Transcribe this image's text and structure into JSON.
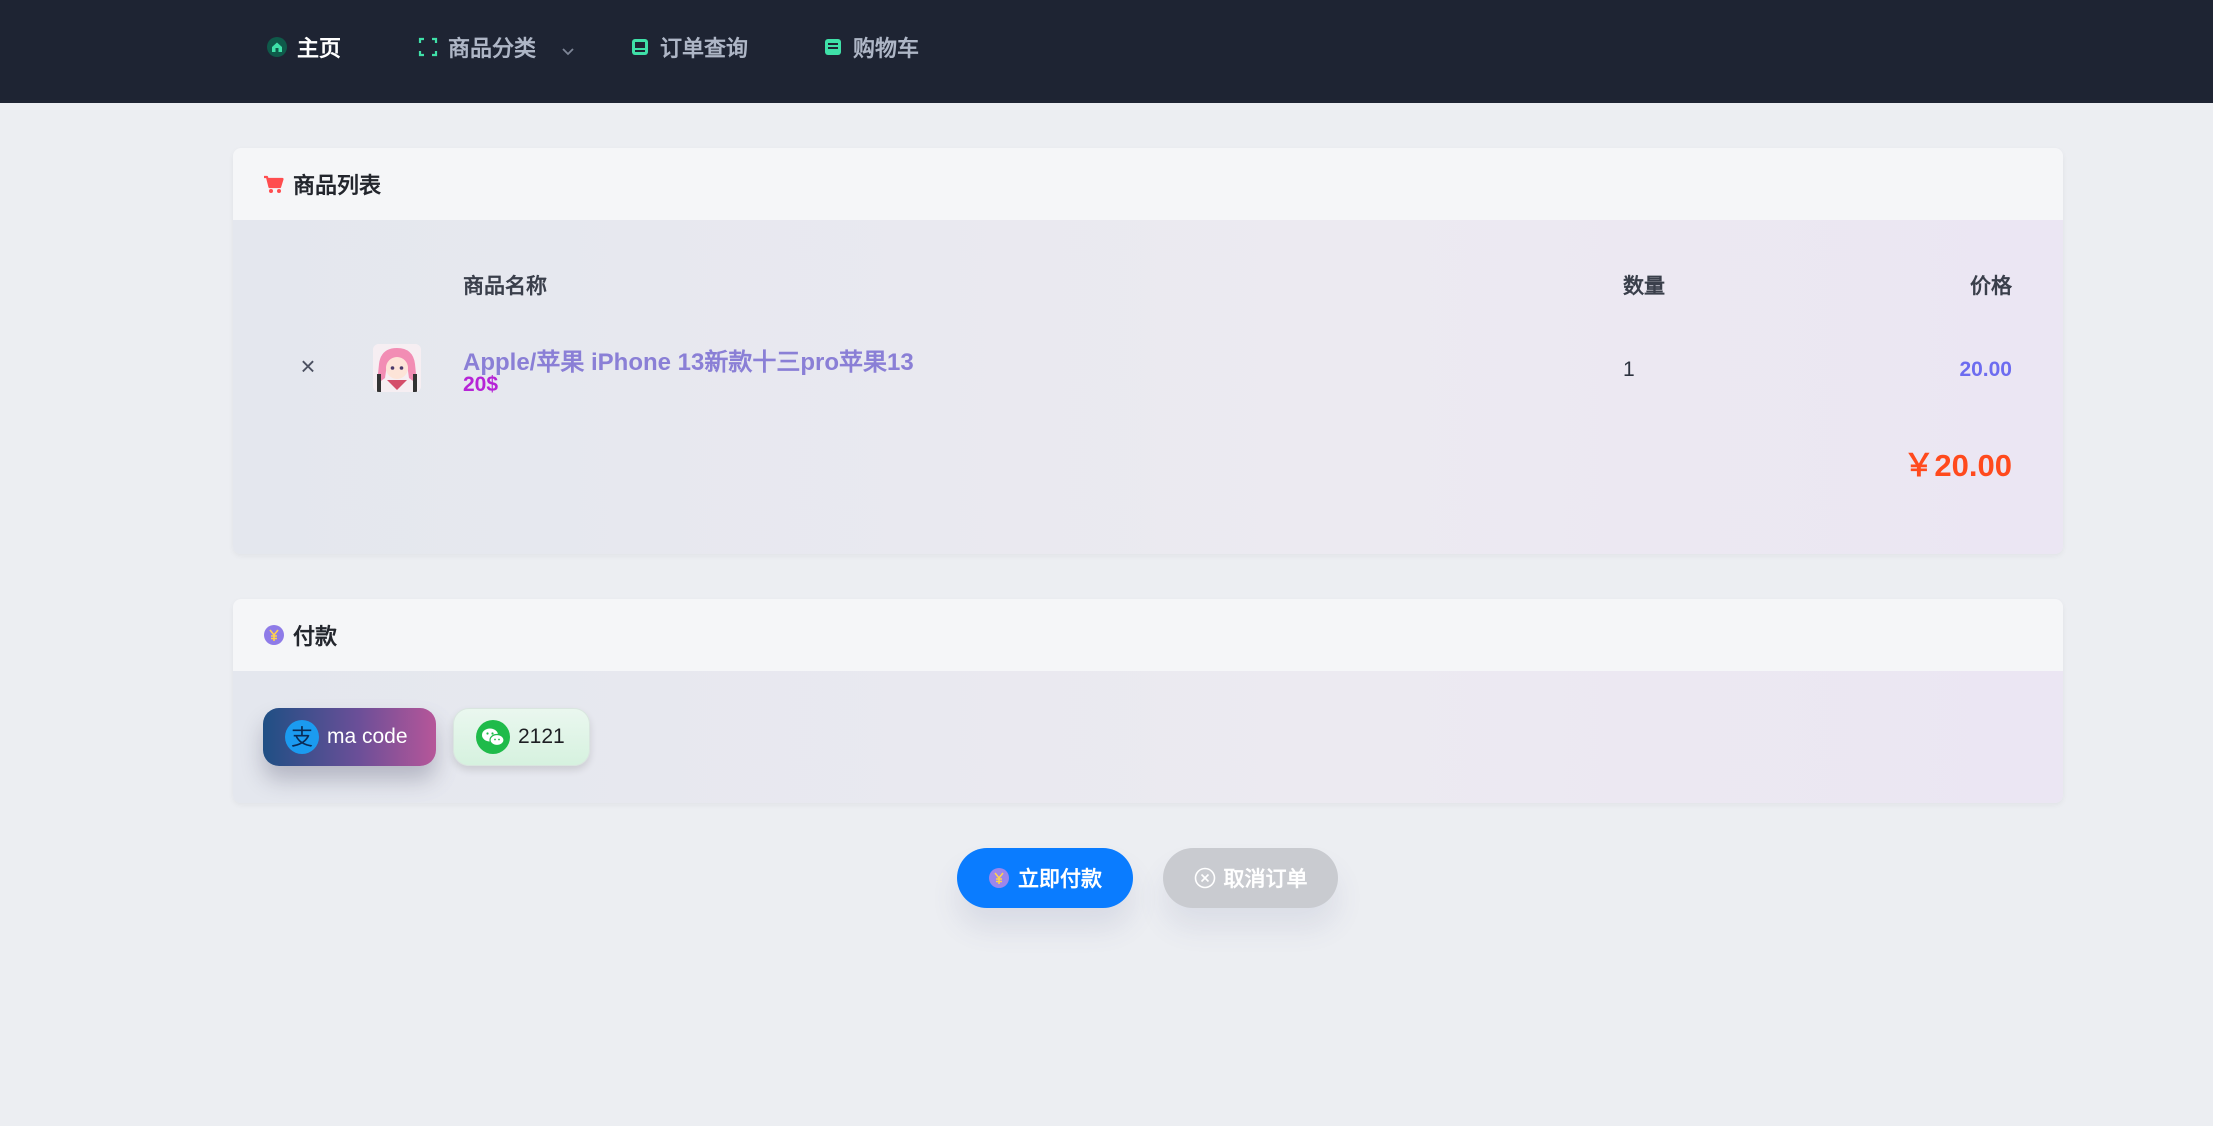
{
  "nav": {
    "home": "主页",
    "category": "商品分类",
    "order_query": "订单查询",
    "cart": "购物车"
  },
  "product_list": {
    "title": "商品列表",
    "columns": {
      "name": "商品名称",
      "quantity": "数量",
      "price": "价格"
    },
    "items": [
      {
        "remove": "×",
        "name": "Apple/苹果 iPhone 13新款十三pro苹果13",
        "unit_price": "20$",
        "quantity": "1",
        "price": "20.00"
      }
    ],
    "total": "￥20.00"
  },
  "payment": {
    "title": "付款",
    "methods": [
      {
        "icon": "alipay-icon",
        "label": "ma code"
      },
      {
        "icon": "wechat-icon",
        "label": "2121"
      }
    ]
  },
  "actions": {
    "pay_now": "立即付款",
    "cancel_order": "取消订单"
  },
  "colors": {
    "nav_bg": "#1e2433",
    "accent_blue": "#0a7cff",
    "total_orange": "#ff4a1d",
    "product_name": "#8a7fd6",
    "unit_price": "#b624d6",
    "row_price": "#6d6cf0"
  }
}
